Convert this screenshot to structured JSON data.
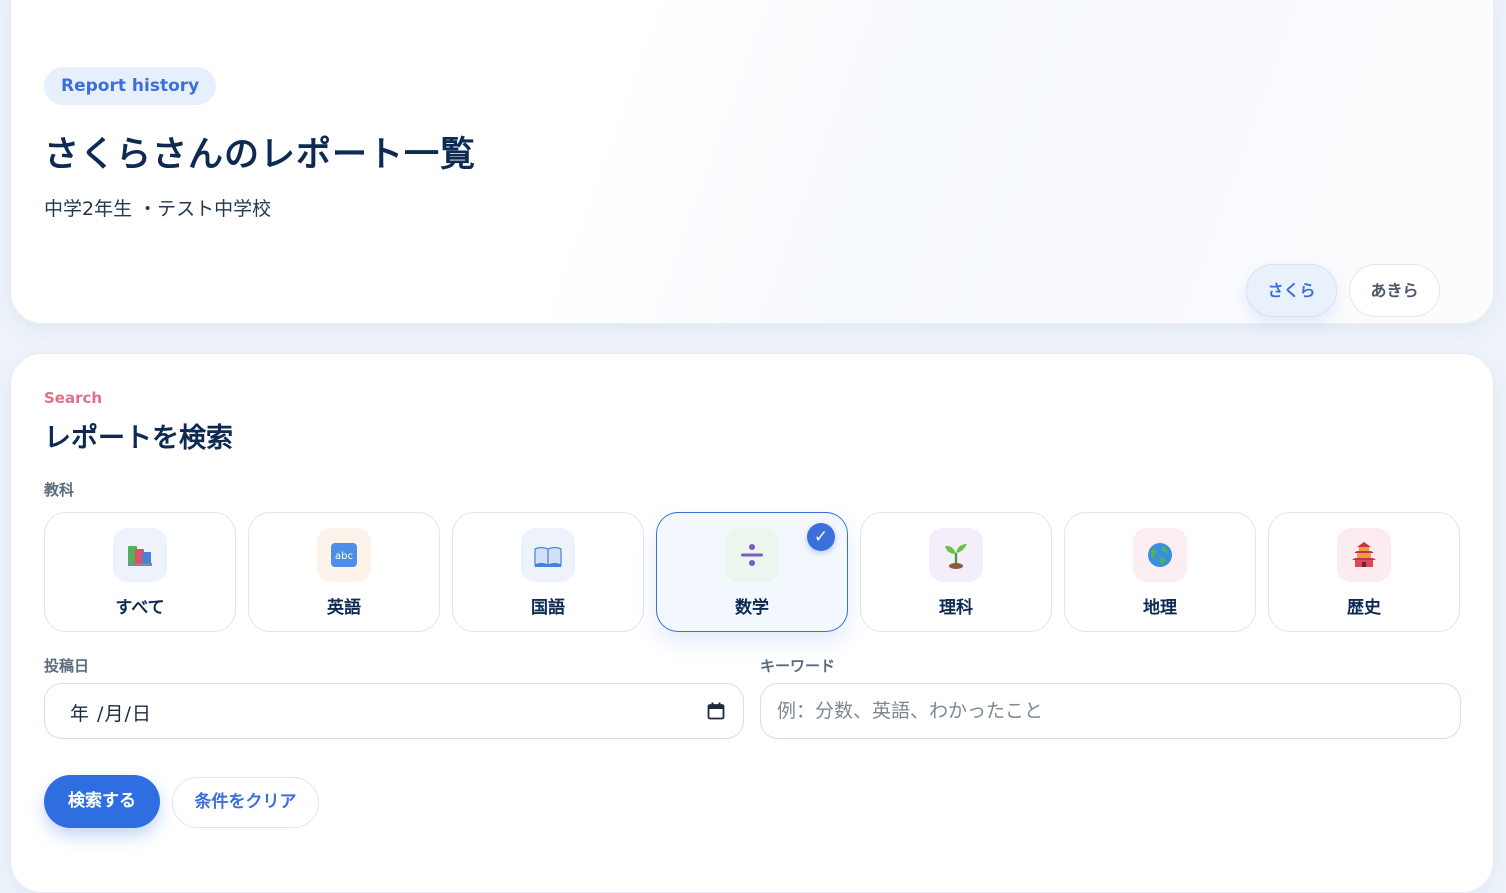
{
  "header": {
    "badge": "Report history",
    "title": "さくらさんのレポート一覧",
    "subtitle": "中学2年生 ・テスト中学校",
    "users": [
      {
        "label": "さくら",
        "active": true
      },
      {
        "label": "あきら",
        "active": false
      }
    ]
  },
  "search": {
    "eyebrow": "Search",
    "title": "レポートを検索",
    "subject_label": "教科",
    "subjects": [
      {
        "label": "すべて",
        "icon": "books-icon",
        "selected": false
      },
      {
        "label": "英語",
        "icon": "abc-icon",
        "selected": false
      },
      {
        "label": "国語",
        "icon": "open-book-icon",
        "selected": false
      },
      {
        "label": "数学",
        "icon": "divide-icon",
        "selected": true
      },
      {
        "label": "理科",
        "icon": "seedling-icon",
        "selected": false
      },
      {
        "label": "地理",
        "icon": "globe-icon",
        "selected": false
      },
      {
        "label": "歴史",
        "icon": "pagoda-icon",
        "selected": false
      }
    ],
    "date_label": "投稿日",
    "date_value": "年 /月/日",
    "keyword_label": "キーワード",
    "keyword_placeholder": "例：分数、英語、わかったこと",
    "keyword_value": "",
    "submit_label": "検索する",
    "clear_label": "条件をクリア"
  },
  "colors": {
    "accent": "#2f6ee0",
    "eyebrow": "#e0708a",
    "title": "#0d2a52"
  }
}
